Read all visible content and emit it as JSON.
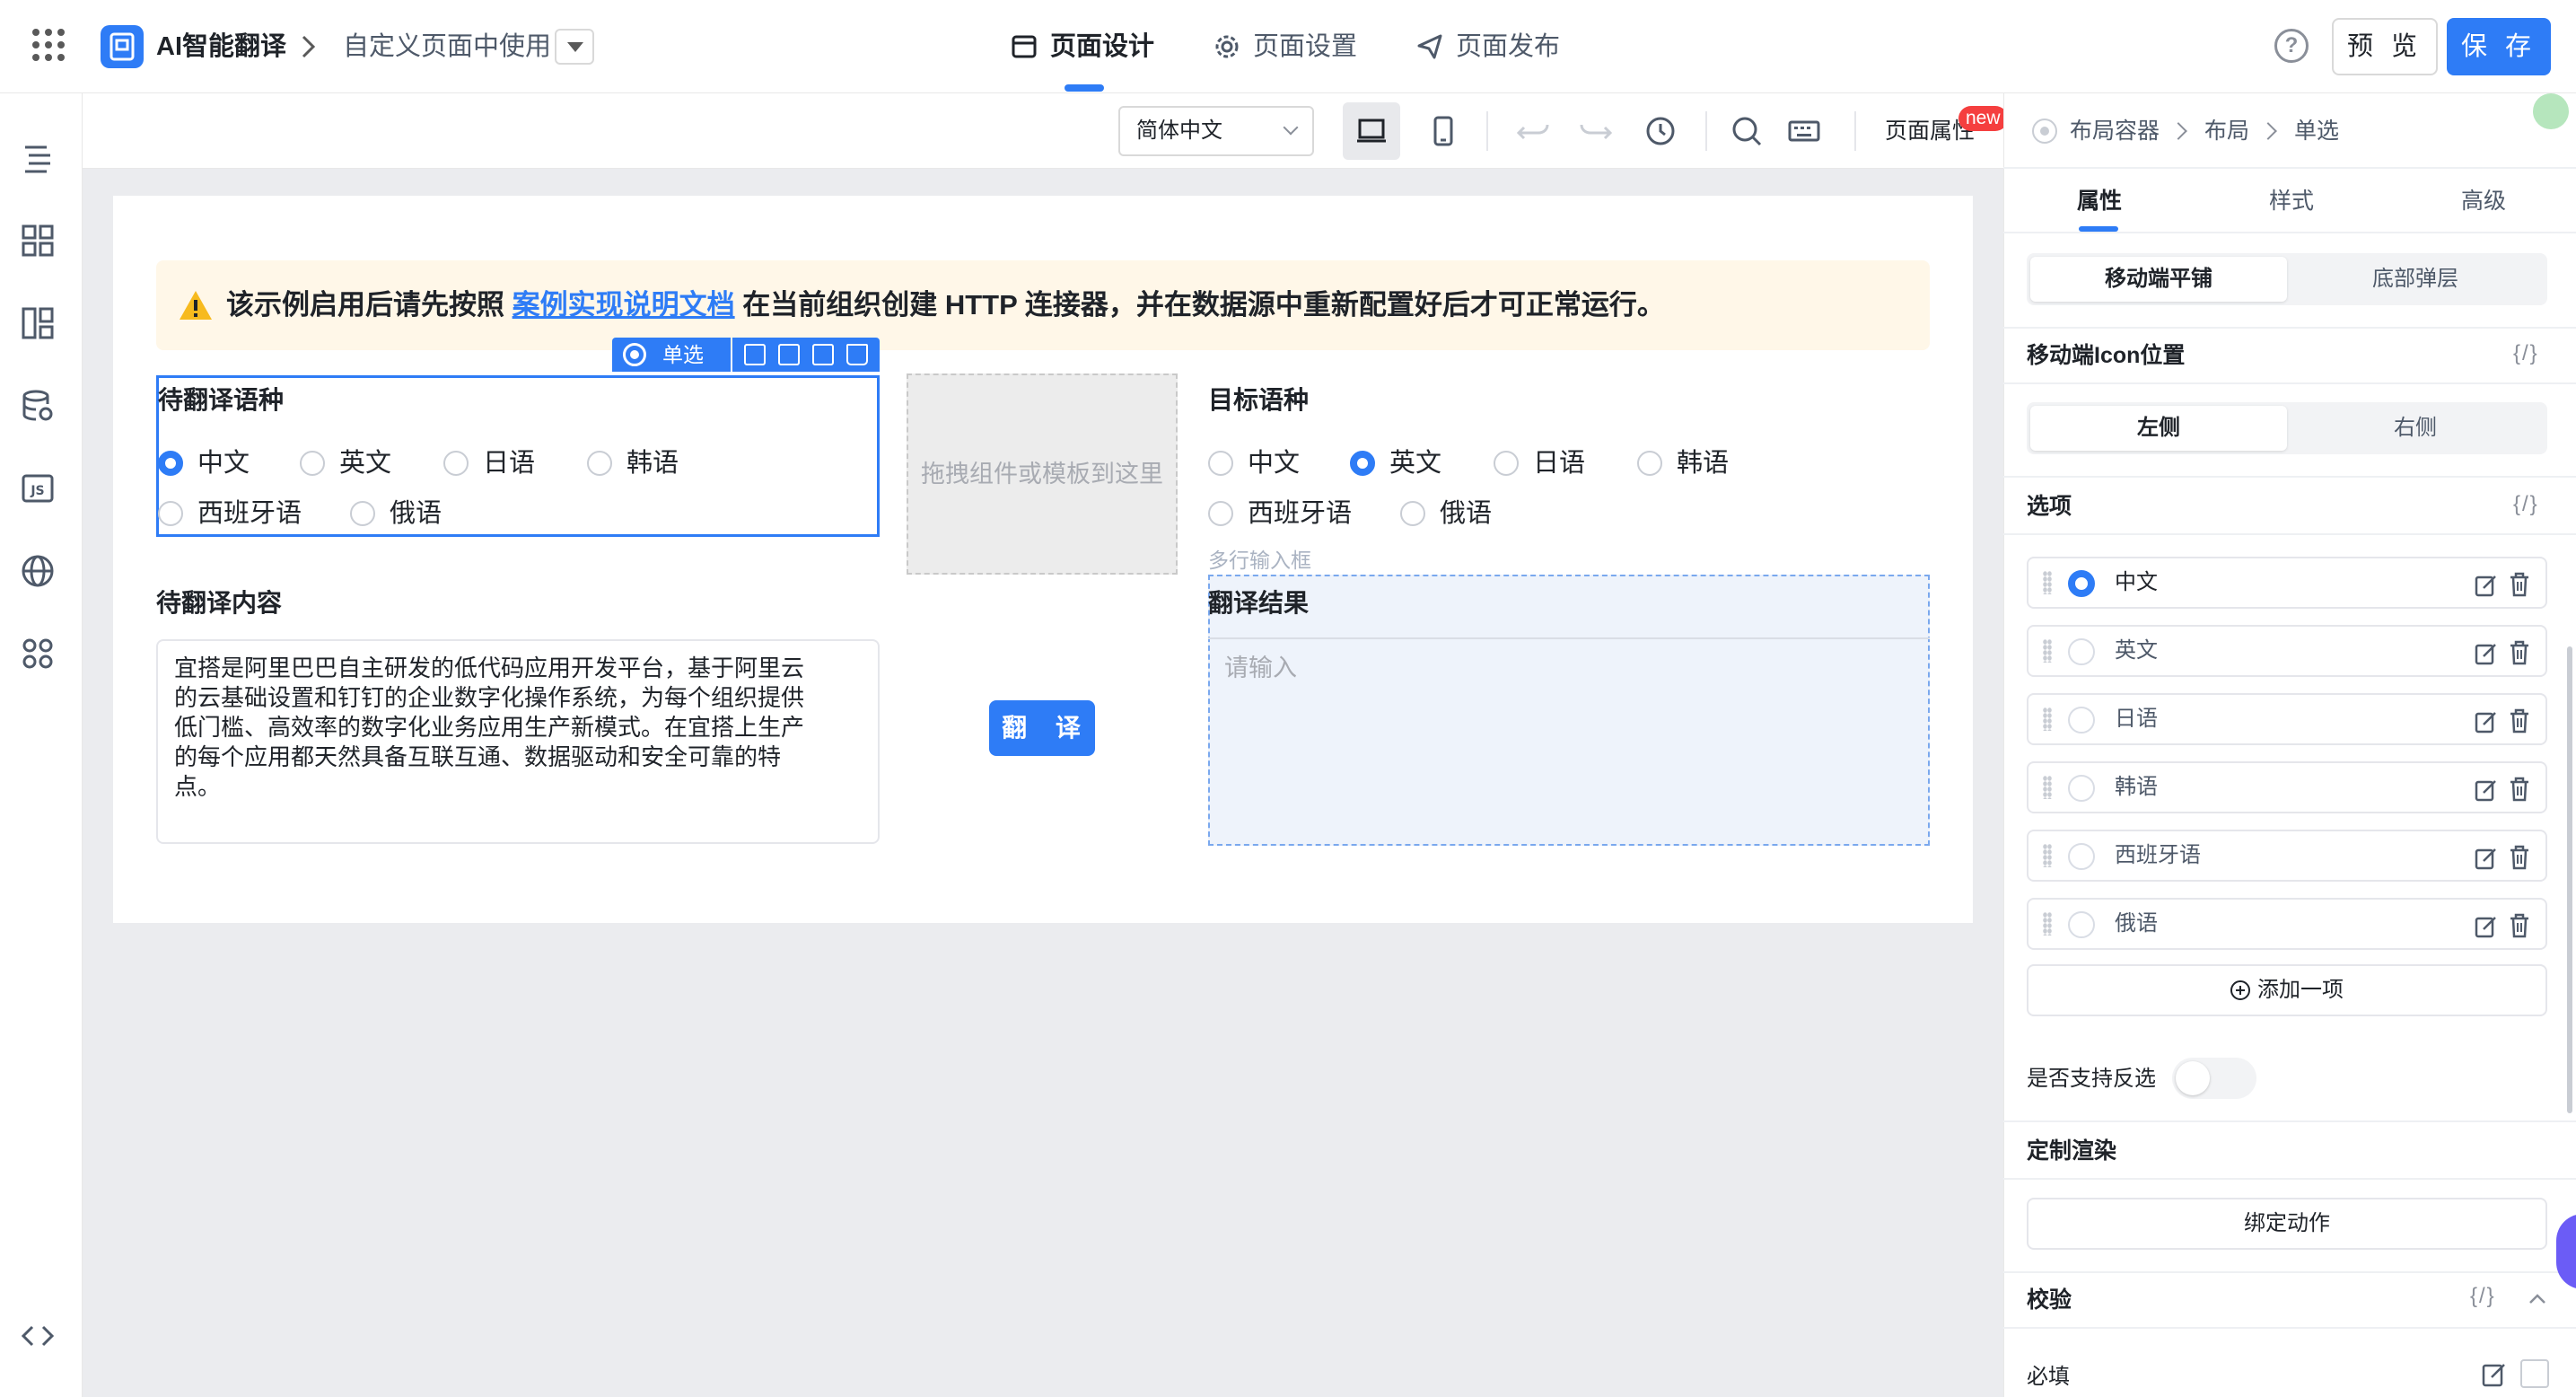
{
  "header": {
    "app_name": "AI智能翻译",
    "page_name": "自定义页面中使用",
    "tabs": [
      {
        "label": "页面设计",
        "icon": "layout-icon",
        "active": true
      },
      {
        "label": "页面设置",
        "icon": "gear-icon",
        "active": false
      },
      {
        "label": "页面发布",
        "icon": "send-icon",
        "active": false
      }
    ],
    "help_label": "?",
    "preview_label": "预 览",
    "save_label": "保 存",
    "accent_color": "#2e7cf6"
  },
  "left_sidebar": {
    "icons": [
      "outline-tree-icon",
      "components-grid-icon",
      "templates-layout-icon",
      "datasource-database-icon",
      "js-code-icon",
      "globe-i18n-icon",
      "extensions-icon",
      "code-brackets-icon"
    ]
  },
  "toolbar": {
    "language_select": "简体中文",
    "page_attr_label": "页面属性",
    "new_badge": "new",
    "tools": [
      "desktop-view-icon",
      "mobile-view-icon",
      "undo-icon",
      "redo-icon",
      "history-icon",
      "search-icon",
      "keyboard-icon"
    ]
  },
  "canvas": {
    "alert": {
      "prefix": "该示例启用后请先按照",
      "link": "案例实现说明文档",
      "suffix": "在当前组织创建 HTTP 连接器，并在数据源中重新配置好后才可正常运行。"
    },
    "selection_tag": "单选",
    "source_language": {
      "label": "待翻译语种",
      "options": [
        "中文",
        "英文",
        "日语",
        "韩语",
        "西班牙语",
        "俄语"
      ],
      "selected": "中文"
    },
    "drop_zone": "拖拽组件或模板到这里",
    "target_language": {
      "label": "目标语种",
      "options": [
        "中文",
        "英文",
        "日语",
        "韩语",
        "西班牙语",
        "俄语"
      ],
      "selected": "英文"
    },
    "source_content": {
      "label": "待翻译内容",
      "lines": [
        "宜搭是阿里巴巴自主研发的低代码应用开发平台，基于阿里云",
        "的云基础设置和钉钉的企业数字化操作系统，为每个组织提供",
        "低门槛、高效率的数字化业务应用生产新模式。在宜搭上生产",
        "的每个应用都天然具备互联互通、数据驱动和安全可靠的特",
        "点。"
      ]
    },
    "translate_button": "翻 译",
    "multiline_hint": "多行输入框",
    "result": {
      "label": "翻译结果",
      "placeholder": "请输入"
    }
  },
  "right_panel": {
    "breadcrumb": [
      "布局容器",
      "布局",
      "单选"
    ],
    "tabs": [
      "属性",
      "样式",
      "高级"
    ],
    "active_tab": "属性",
    "mobile_mode": {
      "options": [
        "移动端平铺",
        "底部弹层"
      ],
      "selected": "移动端平铺"
    },
    "icon_position": {
      "label": "移动端Icon位置",
      "code": "{/}",
      "options": [
        "左侧",
        "右侧"
      ],
      "selected": "左侧"
    },
    "options_section": {
      "label": "选项",
      "code": "{/}"
    },
    "options": [
      {
        "label": "中文",
        "selected": true
      },
      {
        "label": "英文",
        "selected": false
      },
      {
        "label": "日语",
        "selected": false
      },
      {
        "label": "韩语",
        "selected": false
      },
      {
        "label": "西班牙语",
        "selected": false
      },
      {
        "label": "俄语",
        "selected": false
      }
    ],
    "add_item": "添加一项",
    "allow_deselect": {
      "label": "是否支持反选",
      "value": false
    },
    "custom_render": "定制渲染",
    "bind_action": "绑定动作",
    "validation": {
      "label": "校验",
      "code": "{/}"
    },
    "required": {
      "label": "必填",
      "value": false
    }
  }
}
